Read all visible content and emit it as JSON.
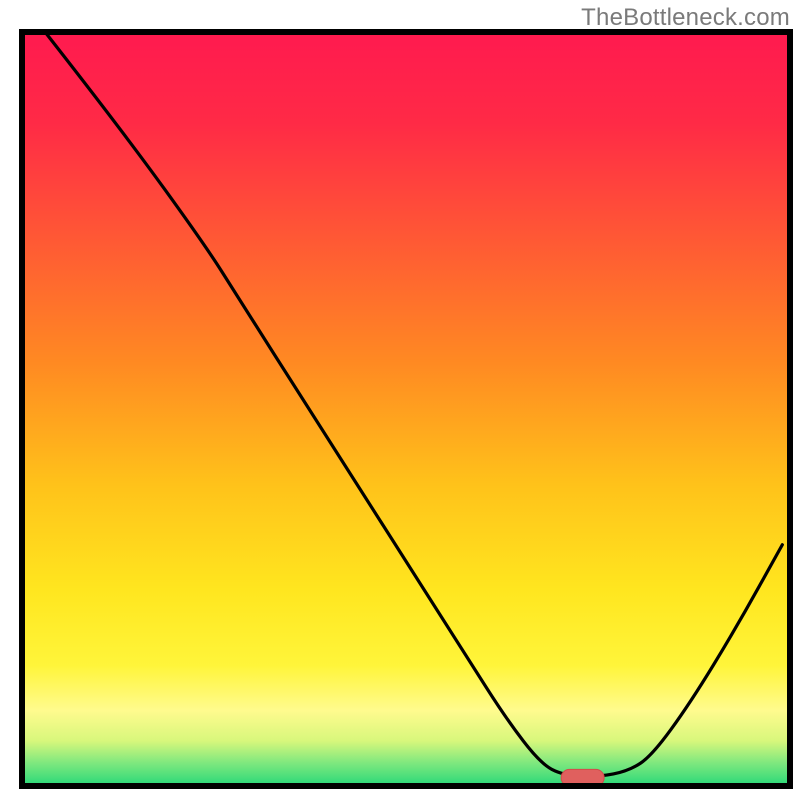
{
  "watermark": "TheBottleneck.com",
  "colors": {
    "border": "#000000",
    "curve": "#000000",
    "marker_fill": "#e0605e",
    "marker_stroke": "#d14c4a",
    "gradient_stops": [
      {
        "offset": 0.0,
        "color": "#ff1a4f"
      },
      {
        "offset": 0.12,
        "color": "#ff2a46"
      },
      {
        "offset": 0.28,
        "color": "#ff5a34"
      },
      {
        "offset": 0.44,
        "color": "#ff8a22"
      },
      {
        "offset": 0.6,
        "color": "#ffc21a"
      },
      {
        "offset": 0.74,
        "color": "#ffe61f"
      },
      {
        "offset": 0.84,
        "color": "#fff53a"
      },
      {
        "offset": 0.9,
        "color": "#fffb8e"
      },
      {
        "offset": 0.94,
        "color": "#d8f77c"
      },
      {
        "offset": 0.97,
        "color": "#7de87e"
      },
      {
        "offset": 1.0,
        "color": "#28d879"
      }
    ]
  },
  "chart_data": {
    "type": "line",
    "title": "",
    "xlabel": "",
    "ylabel": "",
    "xlim": [
      0,
      100
    ],
    "ylim": [
      0,
      100
    ],
    "categories_note": "axes unlabeled; values inferred from pixel geometry on a 0–100 grid",
    "series": [
      {
        "name": "curve",
        "points": [
          {
            "x": 3.0,
            "y": 100.0
          },
          {
            "x": 13.0,
            "y": 87.0
          },
          {
            "x": 24.0,
            "y": 71.5
          },
          {
            "x": 28.0,
            "y": 65.0
          },
          {
            "x": 38.0,
            "y": 49.0
          },
          {
            "x": 48.0,
            "y": 33.0
          },
          {
            "x": 58.0,
            "y": 17.0
          },
          {
            "x": 63.0,
            "y": 9.0
          },
          {
            "x": 67.5,
            "y": 3.0
          },
          {
            "x": 70.5,
            "y": 1.4
          },
          {
            "x": 75.0,
            "y": 1.2
          },
          {
            "x": 79.0,
            "y": 2.0
          },
          {
            "x": 82.0,
            "y": 4.0
          },
          {
            "x": 87.0,
            "y": 11.0
          },
          {
            "x": 93.0,
            "y": 21.0
          },
          {
            "x": 99.0,
            "y": 32.0
          }
        ]
      }
    ],
    "marker": {
      "x": 73.0,
      "y": 1.1,
      "rx": 2.8,
      "ry": 1.1
    }
  }
}
